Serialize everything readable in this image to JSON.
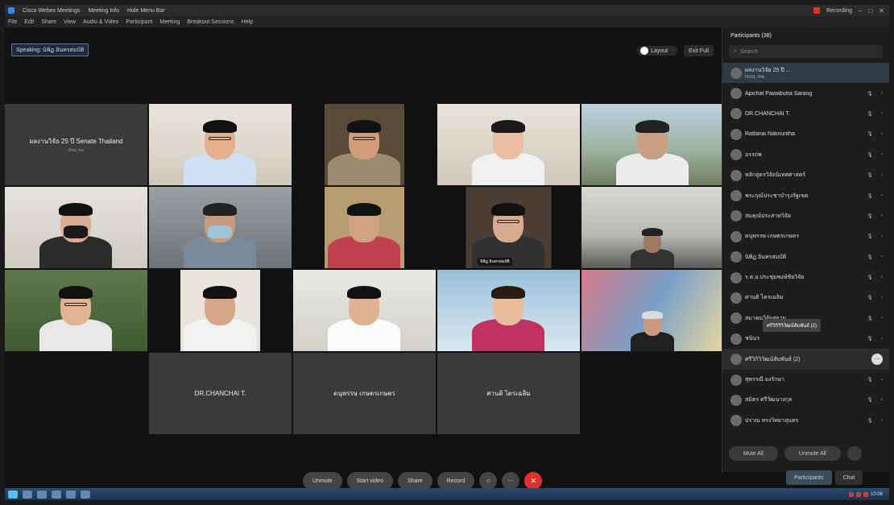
{
  "titlebar": {
    "app": "Cisco Webex Meetings",
    "tabs": [
      "Meeting Info",
      "Hide Menu Bar"
    ],
    "recording": "Recording",
    "controls": [
      "–",
      "□",
      "✕"
    ]
  },
  "menu": [
    "File",
    "Edit",
    "Share",
    "View",
    "Audio & Video",
    "Participant",
    "Meeting",
    "Breakout Sessions",
    "Help"
  ],
  "speaking_label": "Speaking: นิพิฏ อินทรสมบัติ",
  "view": {
    "layout": "Layout",
    "exit": "Exit Full"
  },
  "tiles": [
    {
      "kind": "name",
      "name": "ผลงานวิจัย 25 ปี Senate Thailand",
      "sub": "Host, me"
    },
    {
      "kind": "video",
      "scene": "office-light",
      "skin": "#e6b08f",
      "hair": "#111",
      "shirt": "#cfe0f5",
      "glasses": true
    },
    {
      "kind": "video",
      "scene": "dark-split",
      "skin": "#d19d7a",
      "hair": "#111",
      "shirt": "#9a8b70",
      "glasses": true
    },
    {
      "kind": "video",
      "scene": "office-bright",
      "skin": "#e8bfa0",
      "hair": "#1a1a1a",
      "shirt": "#f0f0f0",
      "glasses": false
    },
    {
      "kind": "video",
      "scene": "mountain",
      "skin": "#caa084",
      "hair": "#222",
      "shirt": "#ececec",
      "glasses": false
    },
    {
      "kind": "video",
      "scene": "wall-light",
      "skin": "#d9ad8e",
      "hair": "#111",
      "shirt": "#2a2a2a",
      "glasses": false,
      "mask": true
    },
    {
      "kind": "video",
      "scene": "room-grey",
      "skin": "#c89b7c",
      "hair": "#222",
      "shirt": "#7a8a9a",
      "glasses": false,
      "mask": true
    },
    {
      "kind": "video",
      "scene": "shelf-red",
      "skin": "#d3a283",
      "hair": "#111",
      "shirt": "#c04050",
      "glasses": false
    },
    {
      "kind": "video",
      "scene": "dark-frame",
      "skin": "#d7ab90",
      "hair": "#111",
      "shirt": "#303030",
      "glasses": true,
      "active": true,
      "tag": "นิพิฏ อินทรสมบัติ"
    },
    {
      "kind": "video",
      "scene": "conference",
      "skin": "#a07a60",
      "hair": "#222",
      "shirt": "#333",
      "glasses": false,
      "small": true
    },
    {
      "kind": "video",
      "scene": "garden",
      "skin": "#e2b494",
      "hair": "#111",
      "shirt": "#e8e8e8",
      "glasses": true
    },
    {
      "kind": "video",
      "scene": "window-split",
      "skin": "#d6a688",
      "hair": "#111",
      "shirt": "#f2f2f2",
      "glasses": false
    },
    {
      "kind": "video",
      "scene": "white-room",
      "skin": "#e1b292",
      "hair": "#111",
      "shirt": "#fafafa",
      "glasses": false
    },
    {
      "kind": "video",
      "scene": "blue-wall",
      "skin": "#e8bb9a",
      "hair": "#2a1a12",
      "shirt": "#c03060",
      "glasses": false
    },
    {
      "kind": "video",
      "scene": "art-wall",
      "skin": "#c99a7d",
      "hair": "#dcdcdc",
      "shirt": "#202020",
      "glasses": false,
      "small": true
    },
    {
      "kind": "blank"
    },
    {
      "kind": "name",
      "name": "DR.CHANCHAI T.",
      "sub": ""
    },
    {
      "kind": "name",
      "name": "ดนุพรรษ เกษตรเกษตร",
      "sub": ""
    },
    {
      "kind": "name",
      "name": "ศานติ ไตรเฉลิม",
      "sub": ""
    },
    {
      "kind": "blank"
    }
  ],
  "controls": {
    "unmute": "Unmute",
    "video": "Start video",
    "share": "Share",
    "record": "Record",
    "end": "✕"
  },
  "participants": {
    "title": "Participants (38)",
    "search": "Search",
    "items": [
      {
        "name": "ผลงานวิจัย 25 ปี ...",
        "role": "Host, me",
        "sel": true
      },
      {
        "name": "Apichat Pawabutra Sarang",
        "role": ""
      },
      {
        "name": "DR.CHANCHAI T.",
        "role": ""
      },
      {
        "name": "Rattanai Naknuntha",
        "role": ""
      },
      {
        "name": "อรรถพ",
        "role": ""
      },
      {
        "name": "หลักสูตรวิจัยนิเทศศาสตร์",
        "role": ""
      },
      {
        "name": "พระกุณ์ประชาบำรุงรัฐเขต",
        "role": ""
      },
      {
        "name": "สมคุณ์ประสาทวิจัย",
        "role": ""
      },
      {
        "name": "ดนุพรรษ เกษตรเกษตร",
        "role": ""
      },
      {
        "name": "นิพิฏ อินทรสมบัติ",
        "role": ""
      },
      {
        "name": "ร.ต.อ.ประชุมพงษ์ชัยวิจัย",
        "role": ""
      },
      {
        "name": "ศานติ ไตรเฉลิม",
        "role": ""
      },
      {
        "name": "สมาคมวิจัยสยาม",
        "role": ""
      },
      {
        "name": "ชนินร",
        "role": "",
        "tooltip": "ศรีวิกิวิวิวัฒน์สัมพันธ์ (2)"
      },
      {
        "name": "ศรีวิกิวิวัฒน์สัมพันธ์ (2)",
        "role": "",
        "hover": true
      },
      {
        "name": "สุพรรณี ยงรักษา",
        "role": ""
      },
      {
        "name": "สมิตร ศรีวัฒนางกุล",
        "role": ""
      },
      {
        "name": "ปราณ ทรงวิทยาสุนทร",
        "role": ""
      }
    ],
    "mute_all": "Mute All",
    "unmute_all": "Unmute All"
  },
  "side_toggle": {
    "participants": "Participants",
    "chat": "Chat"
  },
  "taskbar": {
    "clock": "10:08"
  }
}
